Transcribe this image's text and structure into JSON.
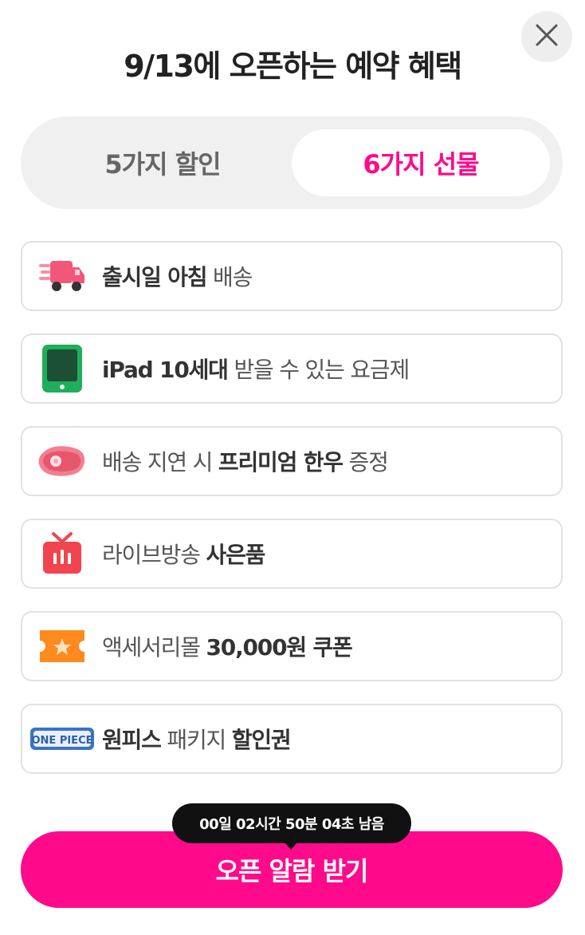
{
  "header": {
    "title": "9/13에 오픈하는 예약 혜택",
    "close_icon": "close-icon"
  },
  "tabs": [
    {
      "label": "5가지 할인",
      "active": false
    },
    {
      "label": "6가지 선물",
      "active": true
    }
  ],
  "accent_color": "#ff0a8a",
  "benefits": [
    {
      "icon": "delivery-truck-icon",
      "parts": [
        {
          "t": "출시일 아침",
          "b": true
        },
        {
          "t": " 배송",
          "b": false
        }
      ]
    },
    {
      "icon": "tablet-icon",
      "parts": [
        {
          "t": "iPad 10세대",
          "b": true
        },
        {
          "t": " 받을 수 있는 요금제",
          "b": false
        }
      ]
    },
    {
      "icon": "beef-icon",
      "parts": [
        {
          "t": "배송 지연 시 ",
          "b": false
        },
        {
          "t": "프리미엄 한우",
          "b": true
        },
        {
          "t": " 증정",
          "b": false
        }
      ]
    },
    {
      "icon": "tv-live-icon",
      "parts": [
        {
          "t": "라이브방송 ",
          "b": false
        },
        {
          "t": "사은품",
          "b": true
        }
      ]
    },
    {
      "icon": "ticket-coupon-icon",
      "parts": [
        {
          "t": "액세서리몰 ",
          "b": false
        },
        {
          "t": "30,000원 쿠폰",
          "b": true
        }
      ]
    },
    {
      "icon": "onepiece-logo-icon",
      "parts": [
        {
          "t": "원피스",
          "b": true
        },
        {
          "t": " 패키지 ",
          "b": false
        },
        {
          "t": "할인권",
          "b": true
        }
      ]
    }
  ],
  "countdown": {
    "text": "00일 02시간 50분 04초 남음"
  },
  "cta": {
    "label": "오픈 알람 받기"
  },
  "logo_text": "ONE PIECE"
}
